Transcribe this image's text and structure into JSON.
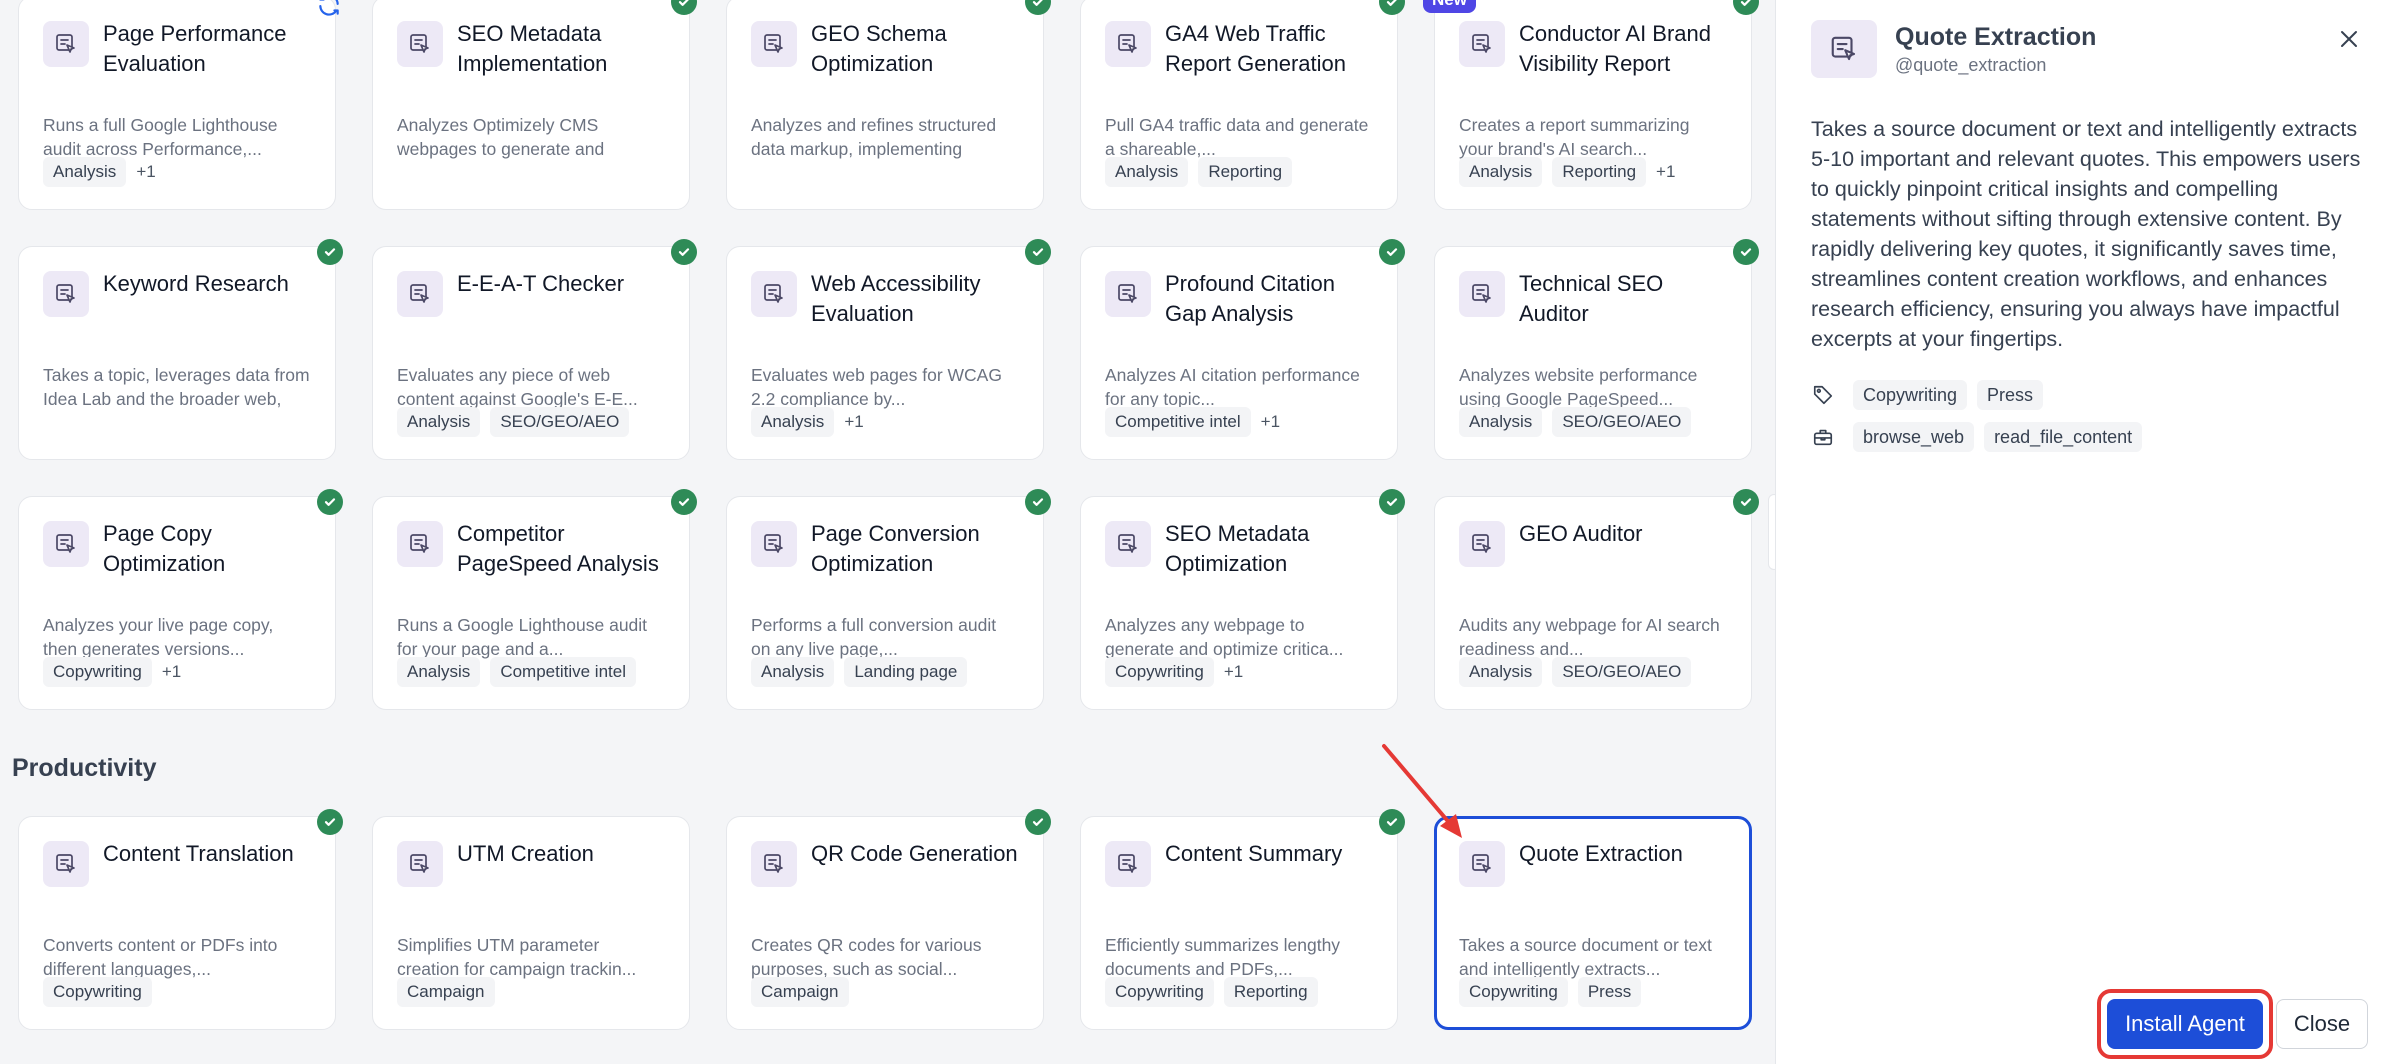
{
  "agents_grid": {
    "cards": [
      {
        "title": "Page Performance Evaluation",
        "description": "Runs a full Google Lighthouse audit across Performance,...",
        "tags": [
          "Analysis"
        ],
        "more": "+1",
        "status": "refresh"
      },
      {
        "title": "SEO Metadata Implementation",
        "description": "Analyzes Optimizely CMS webpages to generate and optimize critical SEO metadat...",
        "tags": [],
        "more": "",
        "status": "check"
      },
      {
        "title": "GEO Schema Optimization",
        "description": "Analyzes and refines structured data markup, implementing schema...",
        "tags": [],
        "more": "",
        "status": "check"
      },
      {
        "title": "GA4 Web Traffic Report Generation",
        "description": "Pull GA4 traffic data and generate a shareable,...",
        "tags": [
          "Analysis",
          "Reporting"
        ],
        "more": "",
        "status": "check"
      },
      {
        "title": "Conductor AI Brand Visibility Report",
        "description": "Creates a report summarizing your brand's AI search...",
        "tags": [
          "Analysis",
          "Reporting"
        ],
        "more": "+1",
        "status": "check",
        "badge": "New"
      },
      {
        "title": "Keyword Research",
        "description": "Takes a topic, leverages data from Idea Lab and the broader web, and returns a curated li...",
        "tags": [],
        "more": "",
        "status": "check"
      },
      {
        "title": "E-E-A-T Checker",
        "description": "Evaluates any piece of web content against Google's E-E...",
        "tags": [
          "Analysis",
          "SEO/GEO/AEO"
        ],
        "more": "",
        "status": "check"
      },
      {
        "title": "Web Accessibility Evaluation",
        "description": "Evaluates web pages for WCAG 2.2 compliance by...",
        "tags": [
          "Analysis"
        ],
        "more": "+1",
        "status": "check"
      },
      {
        "title": "Profound Citation Gap Analysis",
        "description": "Analyzes AI citation performance for any topic...",
        "tags": [
          "Competitive intel"
        ],
        "more": "+1",
        "status": "check"
      },
      {
        "title": "Technical SEO Auditor",
        "description": "Analyzes website performance using Google PageSpeed...",
        "tags": [
          "Analysis",
          "SEO/GEO/AEO"
        ],
        "more": "",
        "status": "check"
      },
      {
        "title": "Page Copy Optimization",
        "description": "Analyzes your live page copy, then generates versions...",
        "tags": [
          "Copywriting"
        ],
        "more": "+1",
        "status": "check"
      },
      {
        "title": "Competitor PageSpeed Analysis",
        "description": "Runs a Google Lighthouse audit for your page and a...",
        "tags": [
          "Analysis",
          "Competitive intel"
        ],
        "more": "",
        "status": "check"
      },
      {
        "title": "Page Conversion Optimization",
        "description": "Performs a full conversion audit on any live page,...",
        "tags": [
          "Analysis",
          "Landing page"
        ],
        "more": "",
        "status": "check"
      },
      {
        "title": "SEO Metadata Optimization",
        "description": "Analyzes any webpage to generate and optimize critica...",
        "tags": [
          "Copywriting"
        ],
        "more": "+1",
        "status": "check"
      },
      {
        "title": "GEO Auditor",
        "description": "Audits any webpage for AI search readiness and...",
        "tags": [
          "Analysis",
          "SEO/GEO/AEO"
        ],
        "more": "",
        "status": "check"
      }
    ]
  },
  "productivity": {
    "heading": "Productivity",
    "cards": [
      {
        "title": "Content Translation",
        "description": "Converts content or PDFs into different languages,...",
        "tags": [
          "Copywriting"
        ],
        "more": "",
        "status": "check"
      },
      {
        "title": "UTM Creation",
        "description": "Simplifies UTM parameter creation for campaign trackin...",
        "tags": [
          "Campaign"
        ],
        "more": "",
        "status": ""
      },
      {
        "title": "QR Code Generation",
        "description": "Creates QR codes for various purposes, such as social...",
        "tags": [
          "Campaign"
        ],
        "more": "",
        "status": "check"
      },
      {
        "title": "Content Summary",
        "description": "Efficiently summarizes lengthy documents and PDFs,...",
        "tags": [
          "Copywriting",
          "Reporting"
        ],
        "more": "",
        "status": "check"
      },
      {
        "title": "Quote Extraction",
        "description": "Takes a source document or text and intelligently extracts...",
        "tags": [
          "Copywriting",
          "Press"
        ],
        "more": "",
        "status": "",
        "selected": true
      }
    ]
  },
  "detail_panel": {
    "title": "Quote Extraction",
    "handle": "@quote_extraction",
    "description": "Takes a source document or text and intelligently extracts 5-10 important and relevant quotes. This empowers users to quickly pinpoint critical insights and compelling statements without sifting through extensive content. By rapidly delivering key quotes, it significantly saves time, streamlines content creation workflows, and enhances research efficiency, ensuring you always have impactful excerpts at your fingertips.",
    "tags": [
      "Copywriting",
      "Press"
    ],
    "tools": [
      "browse_web",
      "read_file_content"
    ],
    "install_label": "Install Agent",
    "close_label": "Close"
  },
  "colors": {
    "accent": "#1d4ed8",
    "check": "#2e8b57",
    "new_badge": "#4f46e5",
    "highlight": "#e53935",
    "icon_bg": "#ede9f6"
  }
}
